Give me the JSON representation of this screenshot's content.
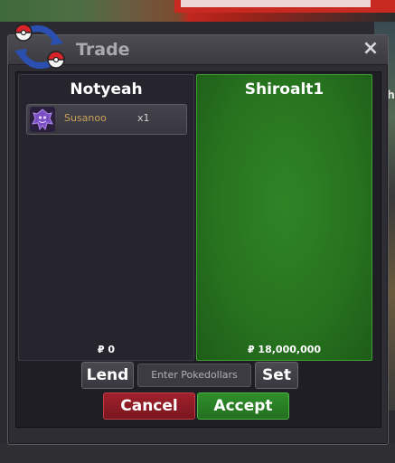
{
  "window": {
    "title": "Trade",
    "close_symbol": "×"
  },
  "background": {
    "partial_text": "ijh"
  },
  "left_panel": {
    "player_name": "Notyeah",
    "items": [
      {
        "name": "Susanoo",
        "quantity": "x1",
        "icon": "susanoo-icon"
      }
    ],
    "money": "₽ 0"
  },
  "right_panel": {
    "player_name": "Shiroalt1",
    "money": "₽ 18,000,000"
  },
  "controls": {
    "lend_label": "Lend",
    "money_placeholder": "Enter Pokedollars",
    "set_label": "Set",
    "cancel_label": "Cancel",
    "accept_label": "Accept"
  },
  "colors": {
    "accept_green": "#2f8f2a",
    "cancel_red": "#a0212c",
    "right_panel_green": "#27741f"
  }
}
